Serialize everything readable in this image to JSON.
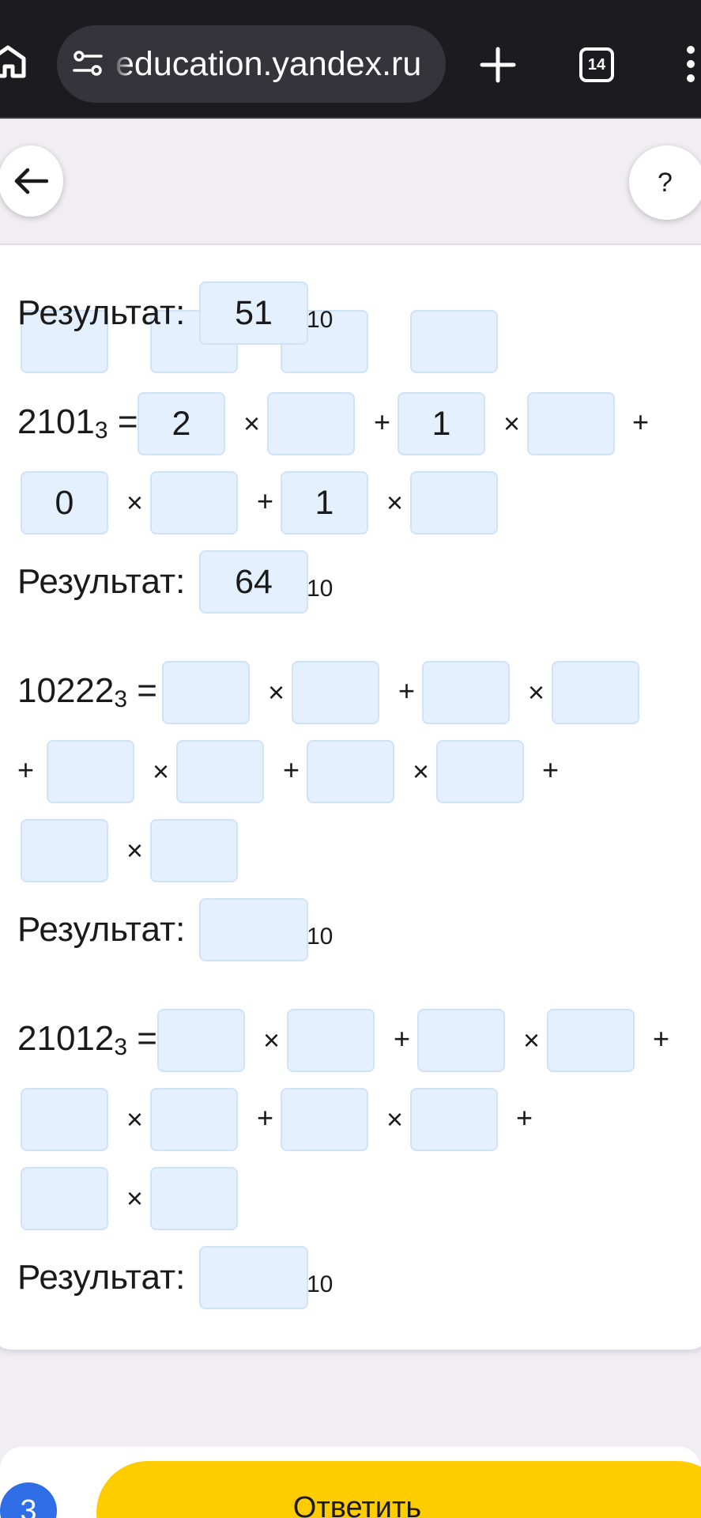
{
  "browser": {
    "url": "education.yandex.ru",
    "tab_count": "14",
    "icons": [
      "home-icon",
      "site-settings-icon",
      "plus-icon",
      "tabs-icon",
      "more-icon"
    ]
  },
  "header": {
    "help_label": "?"
  },
  "problems": [
    {
      "result_label": "Результат:",
      "result_value": "51",
      "base": "10"
    },
    {
      "number": "2101",
      "base_in": "3",
      "equals": "=",
      "terms": [
        {
          "digit": "2",
          "power": ""
        },
        {
          "digit": "1",
          "power": ""
        },
        {
          "digit": "0",
          "power": ""
        },
        {
          "digit": "1",
          "power": ""
        }
      ],
      "result_label": "Результат:",
      "result_value": "64",
      "base": "10"
    },
    {
      "number": "10222",
      "base_in": "3",
      "equals": "=",
      "terms": [
        {
          "digit": "",
          "power": ""
        },
        {
          "digit": "",
          "power": ""
        },
        {
          "digit": "",
          "power": ""
        },
        {
          "digit": "",
          "power": ""
        },
        {
          "digit": "",
          "power": ""
        }
      ],
      "result_label": "Результат:",
      "result_value": "",
      "base": "10"
    },
    {
      "number": "21012",
      "base_in": "3",
      "equals": "=",
      "terms": [
        {
          "digit": "",
          "power": ""
        },
        {
          "digit": "",
          "power": ""
        },
        {
          "digit": "",
          "power": ""
        },
        {
          "digit": "",
          "power": ""
        },
        {
          "digit": "",
          "power": ""
        }
      ],
      "result_label": "Результат:",
      "result_value": "",
      "base": "10"
    }
  ],
  "operators": {
    "times": "×",
    "plus": "+"
  },
  "footer": {
    "step": "3",
    "answer_label": "Ответить"
  },
  "colors": {
    "browser_bg": "#1c1c20",
    "field_bg": "#e4f0fd",
    "accent_yellow": "#ffcc00",
    "badge_blue": "#2f6ee6"
  }
}
